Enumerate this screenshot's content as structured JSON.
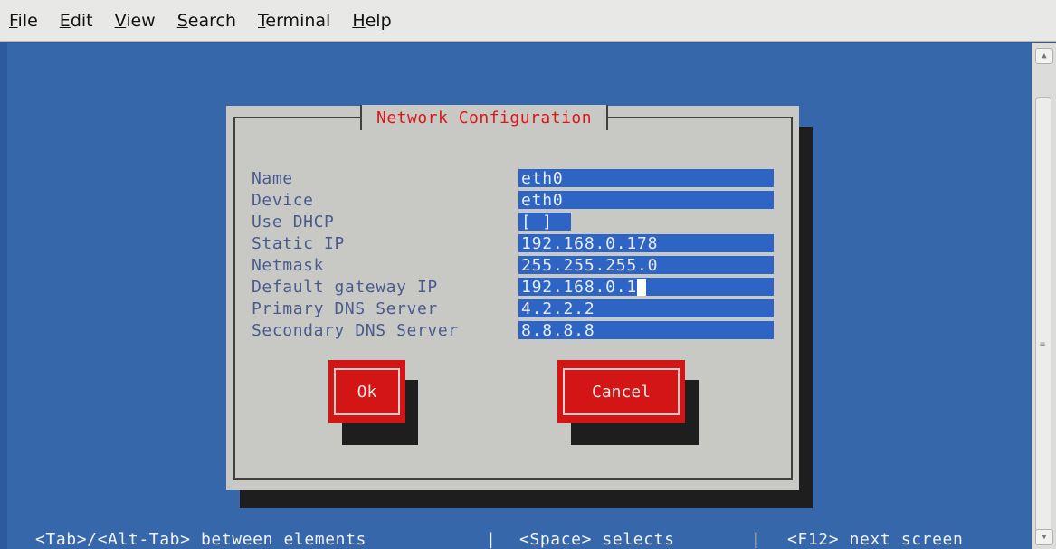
{
  "menubar": {
    "items": [
      "File",
      "Edit",
      "View",
      "Search",
      "Terminal",
      "Help"
    ]
  },
  "dialog": {
    "title": "Network Configuration",
    "fields": [
      {
        "label": "Name",
        "value": "eth0"
      },
      {
        "label": "Device",
        "value": "eth0"
      },
      {
        "label": "Use DHCP",
        "value": "[ ]"
      },
      {
        "label": "Static IP",
        "value": "192.168.0.178"
      },
      {
        "label": "Netmask",
        "value": "255.255.255.0"
      },
      {
        "label": "Default gateway IP",
        "value": "192.168.0.1"
      },
      {
        "label": "Primary DNS Server",
        "value": "4.2.2.2"
      },
      {
        "label": "Secondary DNS Server",
        "value": "8.8.8.8"
      }
    ],
    "ok_label": "Ok",
    "cancel_label": "Cancel"
  },
  "footer": {
    "hint_navigate": "<Tab>/<Alt-Tab> between elements",
    "separator": "|",
    "hint_select": "<Space> selects",
    "hint_next": "<F12> next screen"
  },
  "colors": {
    "background": "#3667aa",
    "dialog": "#c8c8c4",
    "title": "#d81818",
    "field": "#2e64c4",
    "button": "#d31515"
  }
}
